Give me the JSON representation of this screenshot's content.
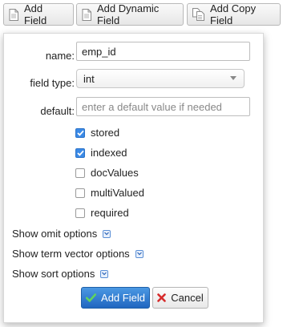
{
  "toolbar": {
    "add_field": {
      "label": "Add Field",
      "icon": "document-icon"
    },
    "add_dynamic_field": {
      "label": "Add Dynamic Field",
      "icon": "document-icon"
    },
    "add_copy_field": {
      "label": "Add Copy Field",
      "icon": "copy-document-icon"
    }
  },
  "form": {
    "name_label": "name:",
    "name_value": "emp_id",
    "field_type_label": "field type:",
    "field_type_value": "int",
    "default_label": "default:",
    "default_placeholder": "enter a default value if needed",
    "checkboxes": [
      {
        "label": "stored",
        "checked": true
      },
      {
        "label": "indexed",
        "checked": true
      },
      {
        "label": "docValues",
        "checked": false
      },
      {
        "label": "multiValued",
        "checked": false
      },
      {
        "label": "required",
        "checked": false
      }
    ],
    "show_options": [
      {
        "label": "Show omit options",
        "icon": "expand-icon"
      },
      {
        "label": "Show term vector options",
        "icon": "expand-icon"
      },
      {
        "label": "Show sort options",
        "icon": "expand-icon"
      }
    ],
    "submit_label": "Add Field",
    "cancel_label": "Cancel"
  },
  "colors": {
    "primary": "#2b78d0",
    "checkbox_on": "#3b8ae6",
    "check_green": "#3cb043",
    "cancel_red": "#d62b2b"
  }
}
